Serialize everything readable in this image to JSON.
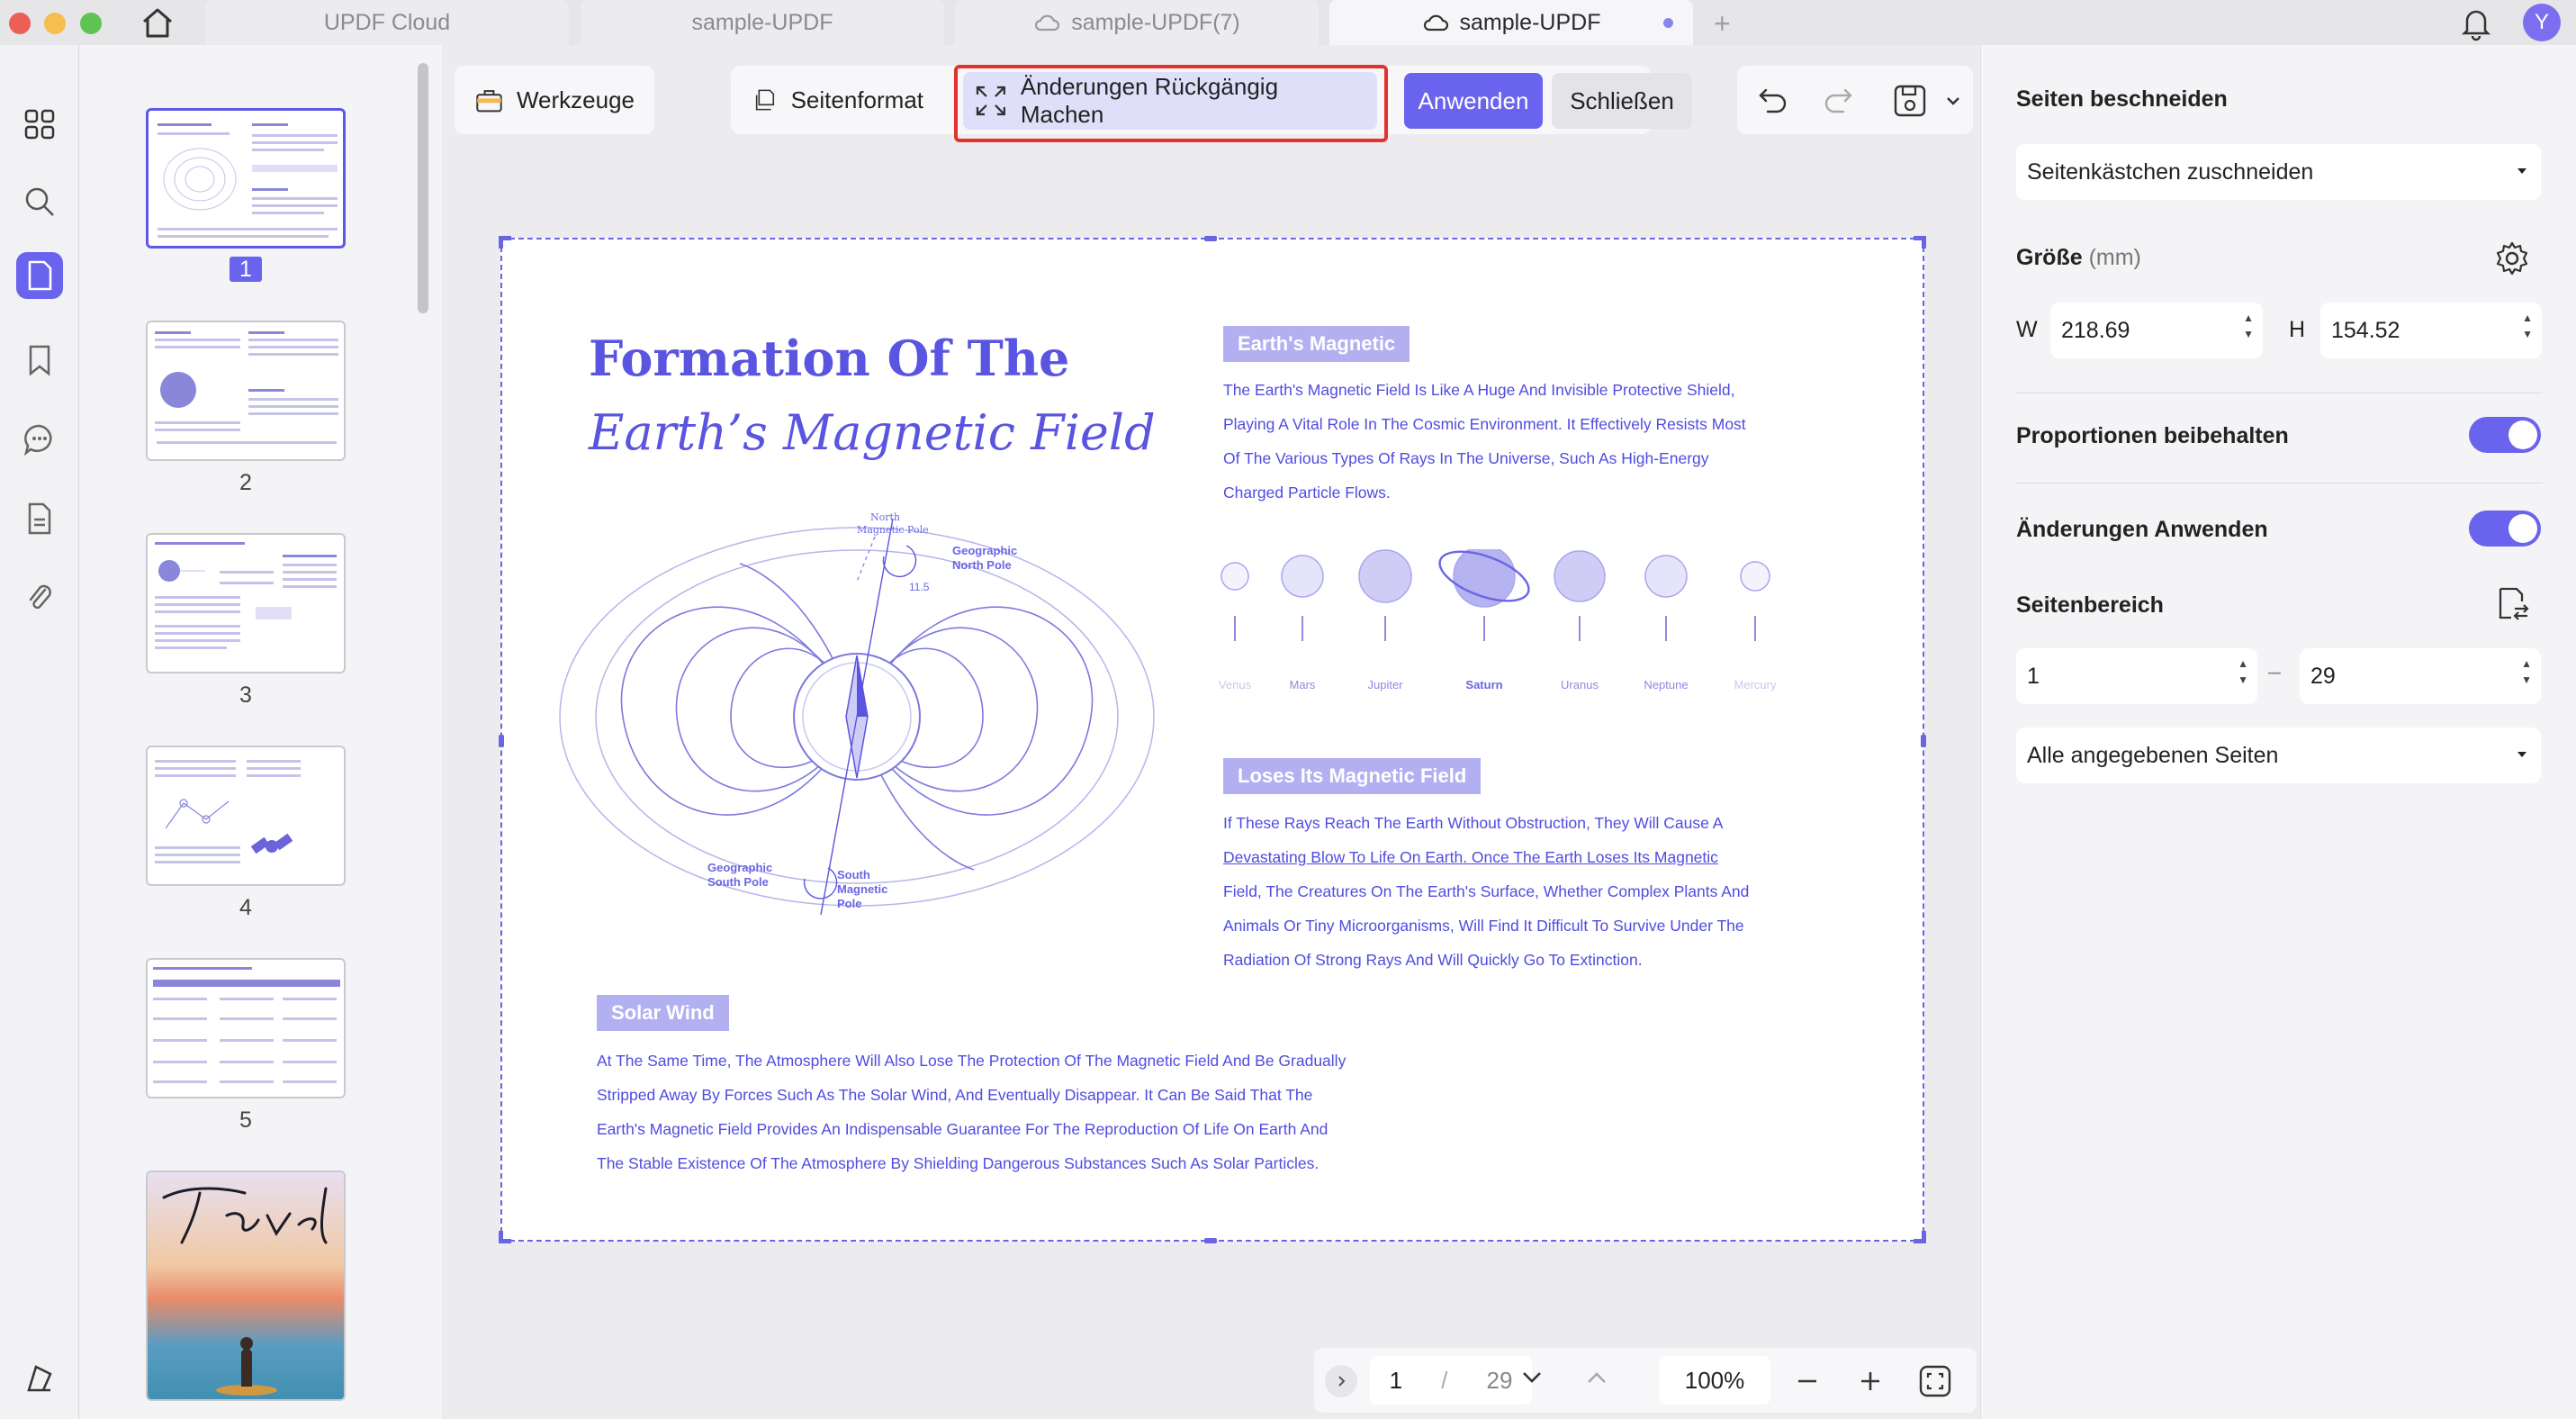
{
  "tabs": [
    {
      "label": "UPDF Cloud",
      "cloud": false
    },
    {
      "label": "sample-UPDF",
      "cloud": false
    },
    {
      "label": "sample-UPDF(7)",
      "cloud": true
    },
    {
      "label": "sample-UPDF",
      "cloud": true,
      "active": true
    }
  ],
  "user": {
    "avatar_letter": "Y"
  },
  "thumbnails": [
    {
      "page": "1",
      "selected": true
    },
    {
      "page": "2"
    },
    {
      "page": "3"
    },
    {
      "page": "4"
    },
    {
      "page": "5"
    }
  ],
  "toolbar": {
    "tools_label": "Werkzeuge",
    "page_format_label": "Seitenformat",
    "undo_changes_label": "Änderungen Rückgängig Machen",
    "apply_label": "Anwenden",
    "close_label": "Schließen"
  },
  "document": {
    "title_line1": "Formation Of The",
    "title_line2": "Earth’s Magnetic Field",
    "diagram_labels": {
      "north_magnetic_pole_1": "North",
      "north_magnetic_pole_2": "Magnetic Pole",
      "geo_north_1": "Geographic",
      "geo_north_2": "North Pole",
      "angle": "11.5",
      "geo_south_1": "Geographic",
      "geo_south_2": "South Pole",
      "south_mag_1": "South",
      "south_mag_2": "Magnetic",
      "south_mag_3": "Pole"
    },
    "section1_tag": "Earth's Magnetic",
    "section1_lines": [
      "The Earth's Magnetic Field Is Like A Huge And Invisible Protective Shield,",
      "Playing A Vital Role In The Cosmic Environment. It Effectively Resists Most",
      "Of The Various Types Of Rays In The Universe, Such As High-Energy",
      "Charged Particle Flows."
    ],
    "planets": [
      "Venus",
      "Mars",
      "Jupiter",
      "Saturn",
      "Uranus",
      "Neptune",
      "Mercury"
    ],
    "section2_tag": "Loses Its Magnetic Field",
    "section2_lines": [
      "If These Rays Reach The Earth Without Obstruction, They Will Cause A",
      "Devastating Blow To Life On Earth. Once The Earth Loses Its Magnetic",
      "Field, The Creatures On The Earth's Surface, Whether Complex Plants And",
      "Animals Or Tiny Microorganisms, Will Find It Difficult To Survive Under The",
      "Radiation Of Strong Rays And Will Quickly Go To Extinction."
    ],
    "section3_tag": "Solar Wind",
    "section3_lines": [
      "At The Same Time, The Atmosphere Will Also Lose The Protection Of The Magnetic Field And Be Gradually",
      "Stripped Away By Forces Such As The Solar Wind, And Eventually Disappear. It Can Be Said That The",
      "Earth's Magnetic Field Provides An Indispensable Guarantee For The Reproduction Of Life On Earth And",
      "The Stable Existence Of The Atmosphere By Shielding Dangerous Substances Such As Solar Particles."
    ]
  },
  "pager": {
    "current": "1",
    "separator": "/",
    "total": "29",
    "zoom": "100%"
  },
  "panel": {
    "crop_heading": "Seiten beschneiden",
    "crop_mode": "Seitenkästchen zuschneiden",
    "size_heading": "Größe",
    "size_unit": "(mm)",
    "w_label": "W",
    "w_value": "218.69",
    "h_label": "H",
    "h_value": "154.52",
    "keep_proportions": "Proportionen beibehalten",
    "apply_changes": "Änderungen Anwenden",
    "range_heading": "Seitenbereich",
    "range_from": "1",
    "range_dash": "–",
    "range_to": "29",
    "range_mode": "Alle angegebenen Seiten"
  },
  "colors": {
    "accent": "#6a63ee",
    "highlight_border": "#e5312b",
    "doc_text": "#4f4ce0"
  },
  "icons": [
    "home-icon",
    "bell-icon",
    "thumbnails-icon",
    "search-icon",
    "page-icon",
    "bookmark-icon",
    "comment-icon",
    "document-icon",
    "attachment-icon",
    "layers-icon",
    "settings-icon",
    "page-range-icon",
    "undo-icon",
    "redo-icon",
    "save-icon",
    "fit-page-icon"
  ]
}
